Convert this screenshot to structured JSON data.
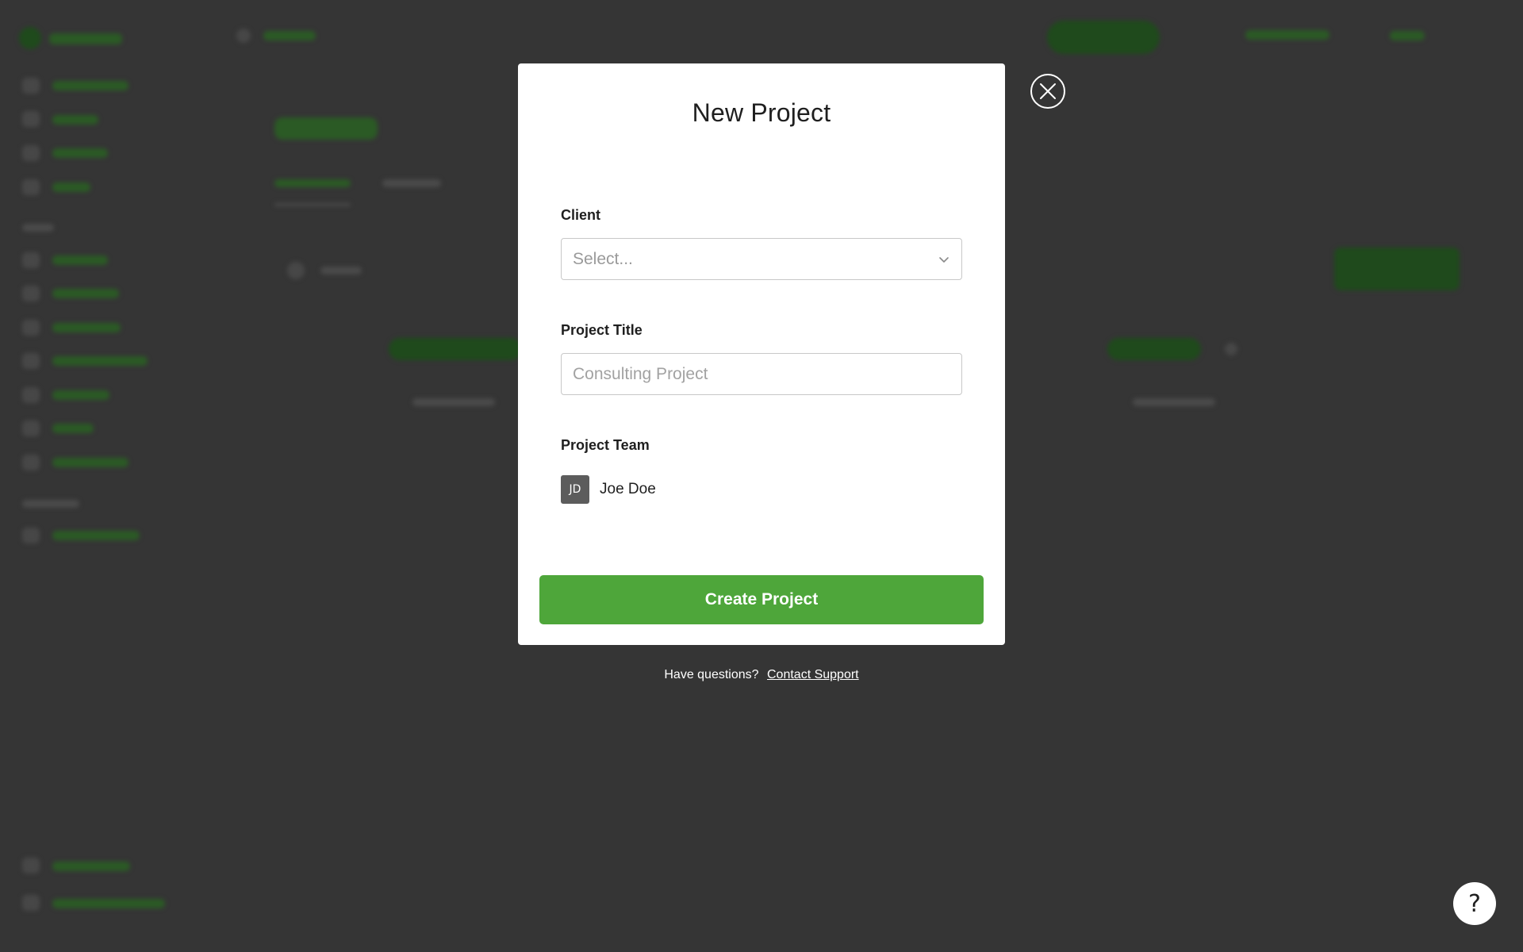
{
  "modal": {
    "title": "New Project",
    "client": {
      "label": "Client",
      "placeholder": "Select..."
    },
    "project_title": {
      "label": "Project Title",
      "placeholder": "Consulting Project"
    },
    "project_team": {
      "label": "Project Team",
      "members": [
        {
          "initials": "JD",
          "name": "Joe Doe"
        }
      ]
    },
    "create_button_label": "Create Project"
  },
  "footer": {
    "question_text": "Have questions?",
    "support_link": "Contact Support"
  },
  "help": {
    "label": "?"
  },
  "icons": {
    "close": "close-icon",
    "chevron": "chevron-down-icon"
  },
  "colors": {
    "accent": "#4ea63a",
    "overlay": "#353535"
  }
}
